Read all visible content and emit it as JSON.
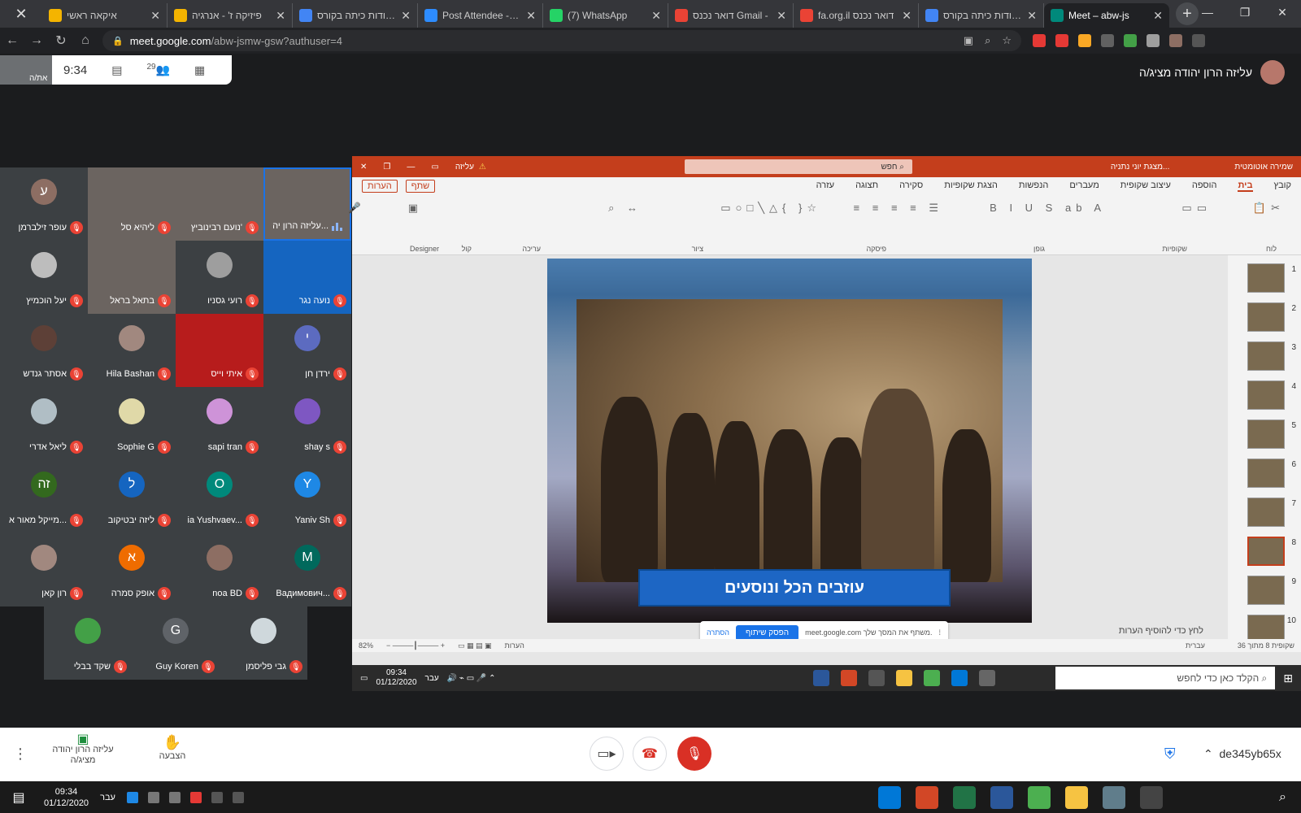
{
  "browser": {
    "tabs": [
      {
        "title": "איקאה ראשי",
        "color": "#f4b400"
      },
      {
        "title": "פיזיקה ז' - אנרגיה",
        "color": "#f4b400"
      },
      {
        "title": "עבודות כיתה בקורס",
        "color": "#4285f4"
      },
      {
        "title": "Post Attendee - Zo",
        "color": "#2d8cff"
      },
      {
        "title": "(7) WhatsApp",
        "color": "#25d366"
      },
      {
        "title": "דואר נכנס Gmail -",
        "color": "#ea4335"
      },
      {
        "title": "fa.org.il דואר נכנס",
        "color": "#ea4335"
      },
      {
        "title": "עבודות כיתה בקורס",
        "color": "#4285f4"
      },
      {
        "title": "Meet – abw-js",
        "color": "#00897b"
      }
    ],
    "url_host": "meet.google.com",
    "url_path": "/abw-jsmw-gsw?authuser=4"
  },
  "meet": {
    "time": "9:34",
    "participant_count": "29",
    "self_label": "את/ה",
    "presenter": "עליזה הרון יהודה מציג/ה",
    "meeting_code": "de345yb65x",
    "controls": {
      "presenting_label": "עליזה הרון יהודה מציג/ה",
      "raise_hand": "הצבעה"
    }
  },
  "participants": [
    {
      "name": "עליזה הרון יה...",
      "initial": "",
      "color": "#6b6460",
      "photo": true,
      "talking": true
    },
    {
      "name": "נועם רבינוביץ'",
      "initial": "",
      "color": "#6b6460",
      "photo": true
    },
    {
      "name": "ליהיא סל",
      "initial": "",
      "color": "#6b6460",
      "photo": true
    },
    {
      "name": "עופר זילברמן",
      "initial": "ע",
      "color": "#8d6e63"
    },
    {
      "name": "נועה נגר",
      "initial": "",
      "color": "#1565c0",
      "photo": true
    },
    {
      "name": "רועי גסניו",
      "initial": "",
      "color": "#9e9e9e"
    },
    {
      "name": "בתאל בראל",
      "initial": "",
      "color": "#6b6460",
      "photo": true
    },
    {
      "name": "יעל הוכמיץ",
      "initial": "",
      "color": "#bdbdbd"
    },
    {
      "name": "ירדן חן",
      "initial": "י",
      "color": "#5c6bc0"
    },
    {
      "name": "איתי וייס",
      "initial": "",
      "color": "#b71c1c",
      "photo": true
    },
    {
      "name": "Hila Bashan",
      "initial": "",
      "color": "#a1887f"
    },
    {
      "name": "אסתר גנדש",
      "initial": "",
      "color": "#5d4037"
    },
    {
      "name": "shay s",
      "initial": "",
      "color": "#7e57c2"
    },
    {
      "name": "sapi tran",
      "initial": "",
      "color": "#ce93d8"
    },
    {
      "name": "Sophie G",
      "initial": "",
      "color": "#e0d9a8"
    },
    {
      "name": "ליאל אדרי",
      "initial": "",
      "color": "#b0bec5"
    },
    {
      "name": "Yaniv Sh",
      "initial": "Y",
      "color": "#1e88e5"
    },
    {
      "name": "ia Yushvaev...",
      "initial": "O",
      "color": "#00897b"
    },
    {
      "name": "ליזה יבטיקוב",
      "initial": "ל",
      "color": "#1565c0"
    },
    {
      "name": "מייקל מאור א...",
      "initial": "זה",
      "color": "#33691e"
    },
    {
      "name": "Вадимович...",
      "initial": "M",
      "color": "#00695c"
    },
    {
      "name": "noa BD",
      "initial": "",
      "color": "#8d6e63"
    },
    {
      "name": "אופק סמרה",
      "initial": "א",
      "color": "#ef6c00"
    },
    {
      "name": "רון קאן",
      "initial": "",
      "color": "#a1887f"
    },
    {
      "name": "שקד בבלי",
      "initial": "",
      "color": "#43a047"
    },
    {
      "name": "Guy Koren",
      "initial": "G",
      "color": "#5f6368"
    },
    {
      "name": "גבי פליסמן",
      "initial": "",
      "color": "#cfd8dc"
    }
  ],
  "ppt": {
    "title_user": "עליזה",
    "search_placeholder": "חפש",
    "autosave": "שמירה אוטומטית",
    "doc_title": "מצגת יוני נתניה...",
    "menu": [
      "קובץ",
      "בית",
      "הוספה",
      "עיצוב שקופית",
      "מעברים",
      "הנפשות",
      "הצגת שקופיות",
      "סקירה",
      "תצוגה",
      "עזרה"
    ],
    "share_btn": "שתף",
    "comments_btn": "הערות",
    "ribbon_groups": [
      "לוח",
      "שקופיות",
      "גופן",
      "פיסקה",
      "ציור",
      "עריכה",
      "קול",
      "Designer"
    ],
    "slide_caption": "עוזבים הכל ונוסעים",
    "notes_hint": "לחץ כדי להוסיף הערות",
    "share_pill_text": "meet.google.com משתף את המסך שלך.",
    "share_pill_stop": "הפסק שיתוף",
    "share_pill_hide": "הסתרה",
    "status_slide": "שקופית 8 מתוך 36",
    "status_lang": "עברית",
    "status_notes": "הערות",
    "status_zoom": "82%",
    "thumb_count": 10,
    "selected_slide": 8,
    "taskbar_time": "09:34",
    "taskbar_date": "01/12/2020",
    "taskbar_lang": "עבר",
    "taskbar_search": "הקלד כאן כדי לחפש"
  },
  "os": {
    "time": "09:34",
    "date": "01/12/2020",
    "lang": "עבר"
  }
}
